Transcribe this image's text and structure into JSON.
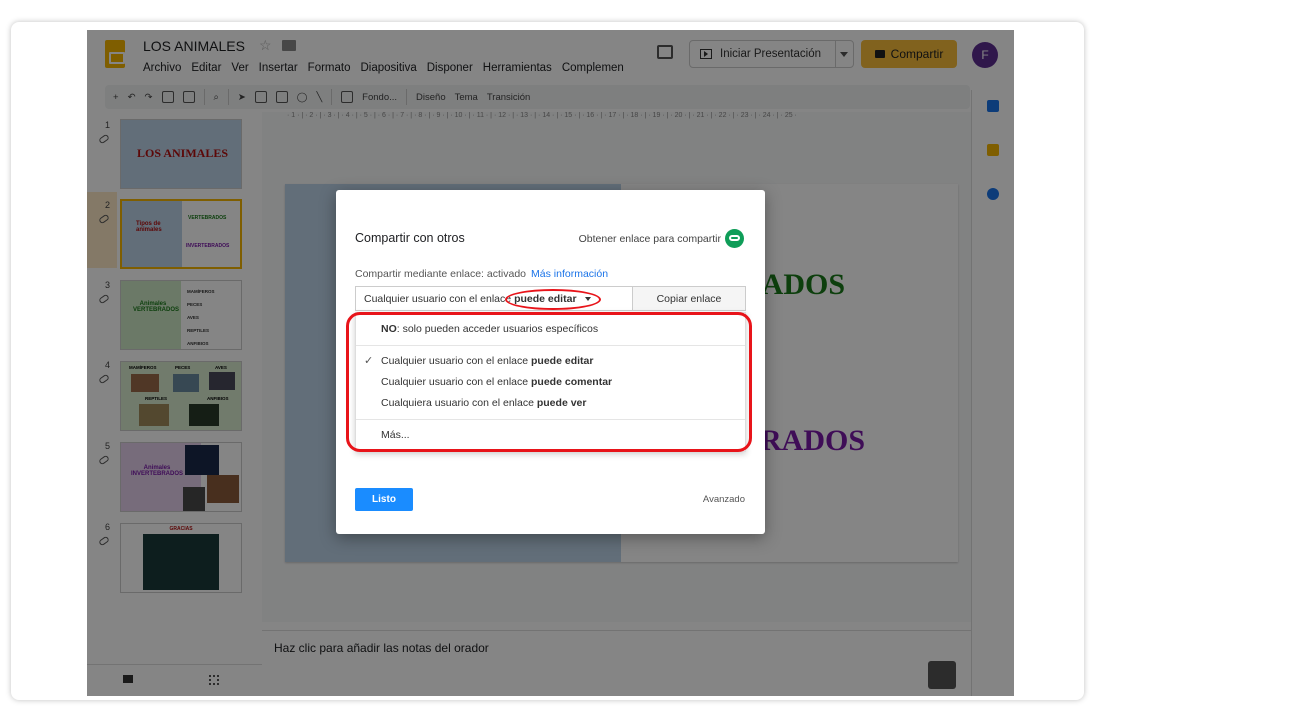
{
  "app": {
    "title": "LOS ANIMALES",
    "menu": [
      "Archivo",
      "Editar",
      "Ver",
      "Insertar",
      "Formato",
      "Diapositiva",
      "Disponer",
      "Herramientas",
      "Complemen"
    ],
    "present_label": "Iniciar Presentación",
    "share_label": "Compartir",
    "avatar_initial": "F",
    "toolbar": {
      "background": "Fondo...",
      "design": "Diseño",
      "theme": "Tema",
      "transition": "Transición"
    }
  },
  "ruler_h": "· 1 · | · 2 · | · 3 · | · 4 · | · 5 · | · 6 · | · 7 · | · 8 · | · 9 · | · 10 · | · 11 · | · 12 · | · 13 · | · 14 · | · 15 · | · 16 · | · 17 · | · 18 · | · 19 · | · 20 · | · 21 · | · 22 · | · 23 · | · 24 · | · 25 ·",
  "slides": [
    {
      "num": "1",
      "title": "LOS ANIMALES"
    },
    {
      "num": "2",
      "title": "Tipos de animales",
      "a": "VERTEBRADOS",
      "b": "INVERTEBRADOS"
    },
    {
      "num": "3",
      "title": "Animales VERTEBRADOS",
      "items": [
        "MAMÍFEROS",
        "PECES",
        "AVES",
        "REPTILES",
        "ANFIBIOS"
      ]
    },
    {
      "num": "4",
      "labels": [
        "MAMÍFEROS",
        "PECES",
        "AVES",
        "REPTILES",
        "ANFIBIOS"
      ]
    },
    {
      "num": "5",
      "title": "Animales INVERTEBRADOS"
    },
    {
      "num": "6",
      "title": "GRACIAS"
    }
  ],
  "main_slide": {
    "text_top": "RADOS",
    "text_bottom": "BRADOS"
  },
  "notes_placeholder": "Haz clic para añadir las notas del orador",
  "dialog": {
    "title": "Compartir con otros",
    "get_link": "Obtener enlace para compartir",
    "status": "Compartir mediante enlace: activado",
    "more_info": "Más información",
    "access_prefix": "Cualquier usuario con el enlace",
    "access_bold": "puede editar",
    "copy_link": "Copiar enlace",
    "options": {
      "no_bold": "NO",
      "no_rest": ": solo pueden acceder usuarios específicos",
      "edit_prefix": "Cualquier usuario con el enlace",
      "edit_bold": "puede editar",
      "comment_prefix": "Cualquier usuario con el enlace",
      "comment_bold": "puede comentar",
      "view_prefix": "Cualquiera usuario con el enlace",
      "view_bold": "puede ver",
      "more": "Más..."
    },
    "done": "Listo",
    "advanced": "Avanzado"
  },
  "colors": {
    "highlight": "#e8141a",
    "share_button": "#f8bd3a",
    "done_button": "#1a8cff"
  }
}
